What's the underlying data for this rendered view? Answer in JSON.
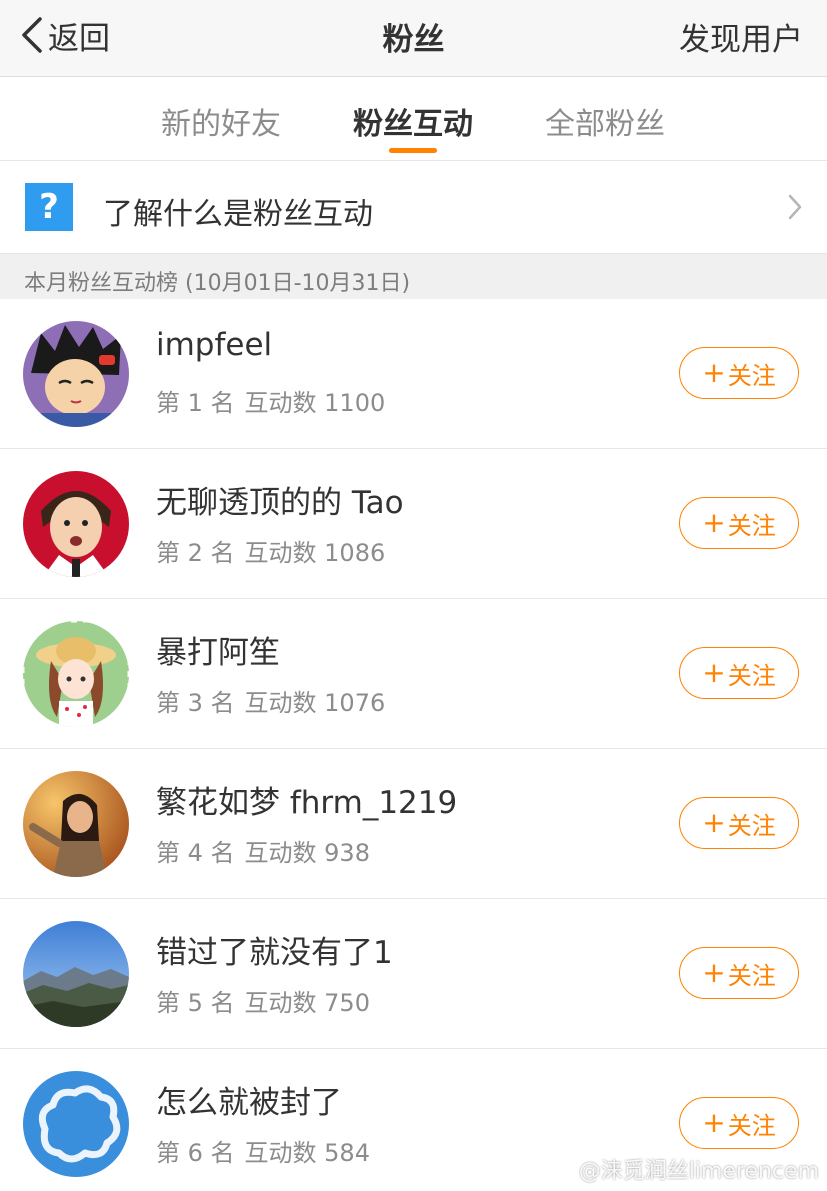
{
  "navbar": {
    "back_label": "返回",
    "title": "粉丝",
    "right_action": "发现用户"
  },
  "tabs": [
    {
      "label": "新的好友",
      "active": false
    },
    {
      "label": "粉丝互动",
      "active": true
    },
    {
      "label": "全部粉丝",
      "active": false
    }
  ],
  "info_link": {
    "icon": "question-icon",
    "icon_text": "?",
    "label": "了解什么是粉丝互动"
  },
  "section_header": "本月粉丝互动榜 (10月01日-10月31日)",
  "follow_label": "关注",
  "fans": [
    {
      "name": "impfeel",
      "rank": "第 1 名",
      "interactions": "互动数 1100"
    },
    {
      "name": "无聊透顶的的 Tao",
      "rank": "第 2 名",
      "interactions": "互动数 1086"
    },
    {
      "name": "暴打阿笙",
      "rank": "第 3 名",
      "interactions": "互动数 1076"
    },
    {
      "name": "繁花如梦 fhrm_1219",
      "rank": "第 4 名",
      "interactions": "互动数 938"
    },
    {
      "name": "错过了就没有了1",
      "rank": "第 5 名",
      "interactions": "互动数 750"
    },
    {
      "name": "怎么就被封了",
      "rank": "第 6 名",
      "interactions": "互动数 584"
    }
  ],
  "watermark": "@涞觅润丝limerencem",
  "colors": {
    "accent": "#ff8200",
    "question_icon": "#2f9cef",
    "nav_bg": "#f7f7f7",
    "section_bg": "#f0f0f0"
  }
}
